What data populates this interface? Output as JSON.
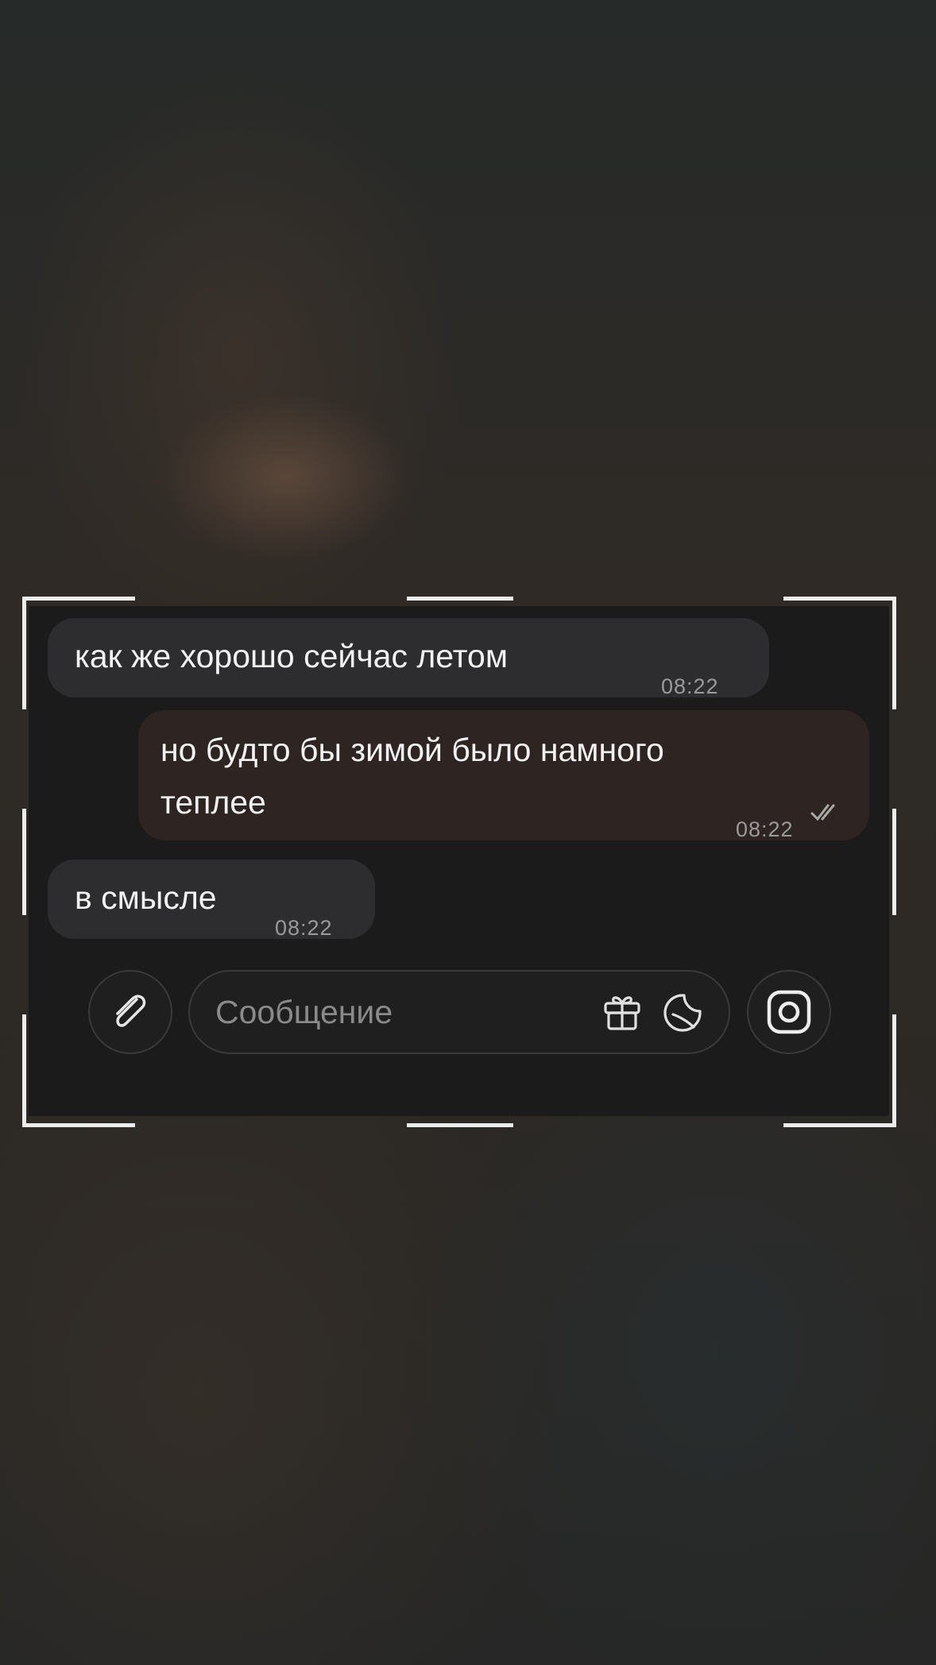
{
  "messages": [
    {
      "direction": "incoming",
      "text": "как же хорошо сейчас летом",
      "time": "08:22"
    },
    {
      "direction": "outgoing",
      "line1": "но будто бы зимой было намного",
      "line2": "теплее",
      "time": "08:22",
      "status_icon": "double-check-icon"
    },
    {
      "direction": "incoming",
      "text": "в смысле",
      "time": "08:22"
    }
  ],
  "composer": {
    "placeholder": "Сообщение",
    "attach_icon": "paperclip-icon",
    "gift_icon": "gift-icon",
    "sticker_icon": "sticker-icon",
    "camera_icon": "camera-icon"
  },
  "colors": {
    "card_background": "#1c1b1c",
    "incoming_bubble": "#2d2c2e",
    "outgoing_bubble": "#2e2421",
    "frame_lines": "#ececec"
  }
}
